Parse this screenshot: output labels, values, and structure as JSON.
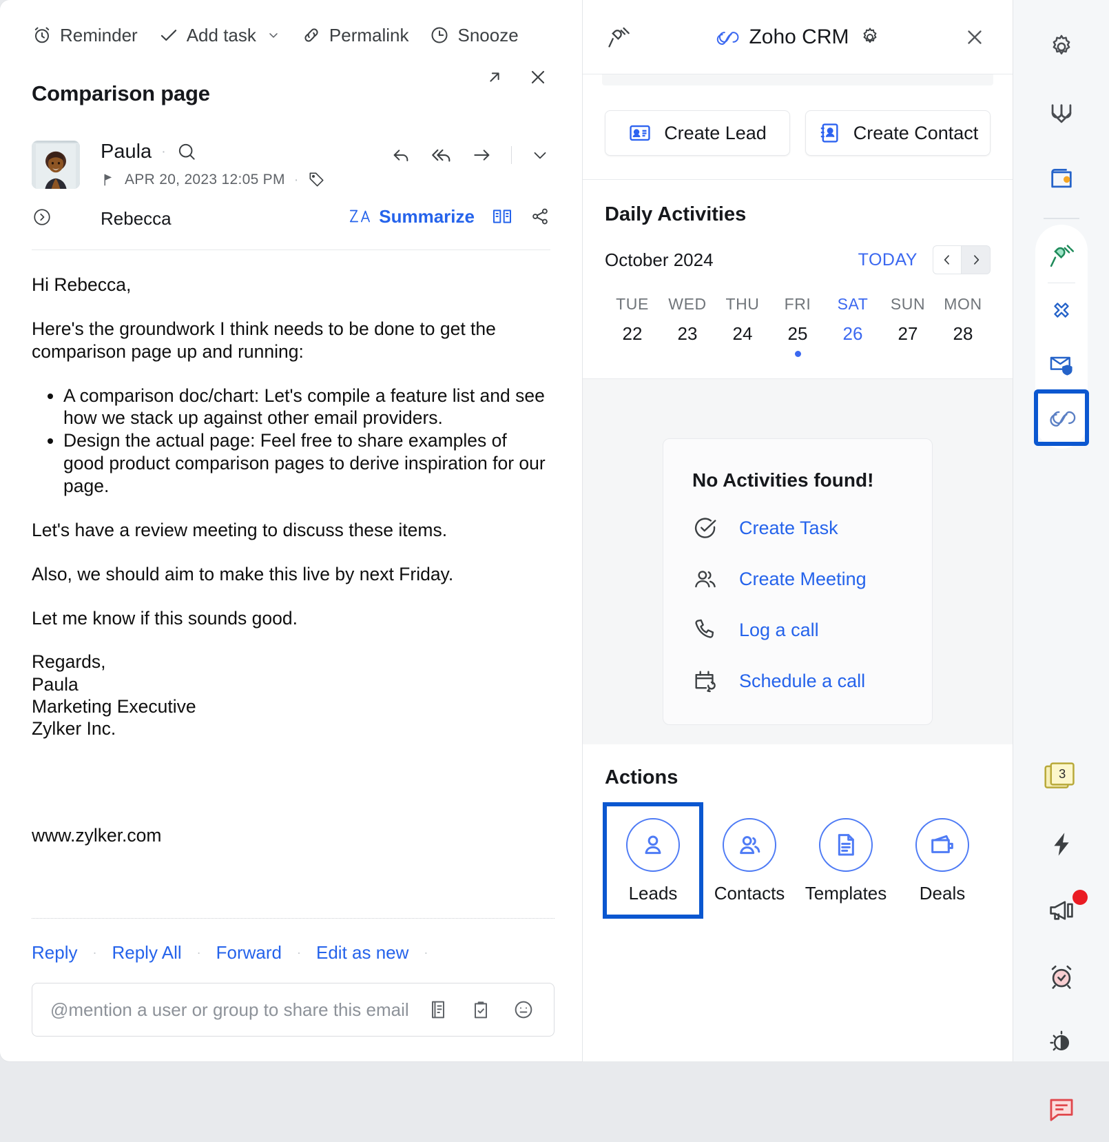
{
  "mail": {
    "toolbar": [
      {
        "label": "Reminder",
        "icon": "alarm-clock-icon"
      },
      {
        "label": "Add task",
        "icon": "check-icon",
        "caret": true
      },
      {
        "label": "Permalink",
        "icon": "link-icon"
      },
      {
        "label": "Snooze",
        "icon": "clock-icon"
      }
    ],
    "window_controls": [
      {
        "name": "popout-icon"
      },
      {
        "name": "close-icon"
      }
    ],
    "subject": "Comparison page",
    "sender": "Paula",
    "date": "APR 20, 2023 12:05 PM",
    "recipient": "Rebecca",
    "summarize_label": "Summarize",
    "message_actions": [
      "reply-icon",
      "reply-all-icon",
      "forward-icon",
      "chevron-down-icon"
    ],
    "body": {
      "greeting": "Hi Rebecca,",
      "intro": "Here's the groundwork I think needs to be done to get the comparison page up and running:",
      "bullets": [
        "A comparison doc/chart: Let's compile a feature list and see how we stack up against other email providers.",
        "Design the actual page: Feel free to share examples of good product comparison pages to derive inspiration for our page."
      ],
      "line1": "Let's have a review meeting to discuss these items.",
      "line2": "Also, we should aim to make this live by next Friday.",
      "line3": "Let me know if this sounds good.",
      "sign_off": "Regards,",
      "sig_name": "Paula",
      "sig_title": "Marketing Executive",
      "sig_company": "Zylker Inc.",
      "website": "www.zylker.com"
    },
    "reply_links": [
      "Reply",
      "Reply All",
      "Forward",
      "Edit as new"
    ],
    "mention_placeholder": "@mention a user or group to share this email",
    "mention_icons": [
      "note-icon",
      "clipboard-check-icon",
      "emoji-icon"
    ]
  },
  "crm": {
    "title": "Zoho CRM",
    "header_icons": [
      "plug-icon",
      "crm-logo-icon",
      "gear-icon",
      "close-icon"
    ],
    "create_buttons": [
      {
        "label": "Create Lead",
        "icon": "lead-card-icon"
      },
      {
        "label": "Create Contact",
        "icon": "contact-book-icon"
      }
    ],
    "daily": {
      "title": "Daily Activities",
      "month": "October 2024",
      "today_label": "TODAY",
      "prev_icon": "chevron-left-icon",
      "next_icon": "chevron-right-icon",
      "weekdays": [
        "TUE",
        "WED",
        "THU",
        "FRI",
        "SAT",
        "SUN",
        "MON"
      ],
      "days": [
        "22",
        "23",
        "24",
        "25",
        "26",
        "27",
        "28"
      ],
      "selected_index": 4,
      "dot_index": 3
    },
    "no_activities": {
      "title": "No Activities found!",
      "items": [
        {
          "label": "Create Task",
          "icon": "check-circle-icon"
        },
        {
          "label": "Create Meeting",
          "icon": "people-icon"
        },
        {
          "label": "Log a call",
          "icon": "phone-icon"
        },
        {
          "label": "Schedule a call",
          "icon": "calendar-clock-icon"
        }
      ]
    },
    "actions": {
      "title": "Actions",
      "items": [
        {
          "label": "Leads",
          "icon": "person-icon",
          "highlighted": true
        },
        {
          "label": "Contacts",
          "icon": "people-icon",
          "highlighted": false
        },
        {
          "label": "Templates",
          "icon": "document-icon",
          "highlighted": false
        },
        {
          "label": "Deals",
          "icon": "wallet-icon",
          "highlighted": false
        }
      ]
    }
  },
  "rail": {
    "top_items": [
      {
        "name": "gear-icon"
      },
      {
        "name": "clip-logo-icon"
      },
      {
        "name": "wallet-icon"
      }
    ],
    "pill_items": [
      {
        "name": "plug-green-icon"
      },
      {
        "name": "flower-icon"
      },
      {
        "name": "mail-shield-icon"
      },
      {
        "name": "crm-link-icon",
        "highlighted": true
      }
    ],
    "bottom_items": [
      {
        "name": "sticky-notes-icon",
        "badge": "3"
      },
      {
        "name": "bolt-icon"
      },
      {
        "name": "megaphone-icon",
        "dot": true
      },
      {
        "name": "alarm-icon"
      },
      {
        "name": "theme-icon"
      },
      {
        "name": "chat-icon"
      }
    ]
  },
  "colors": {
    "accent_blue": "#2563eb",
    "highlight_blue": "#0b57d0",
    "calendar_blue": "#3b68f0",
    "icon_gray": "#3c4043",
    "red_badge": "#ea1c24"
  }
}
